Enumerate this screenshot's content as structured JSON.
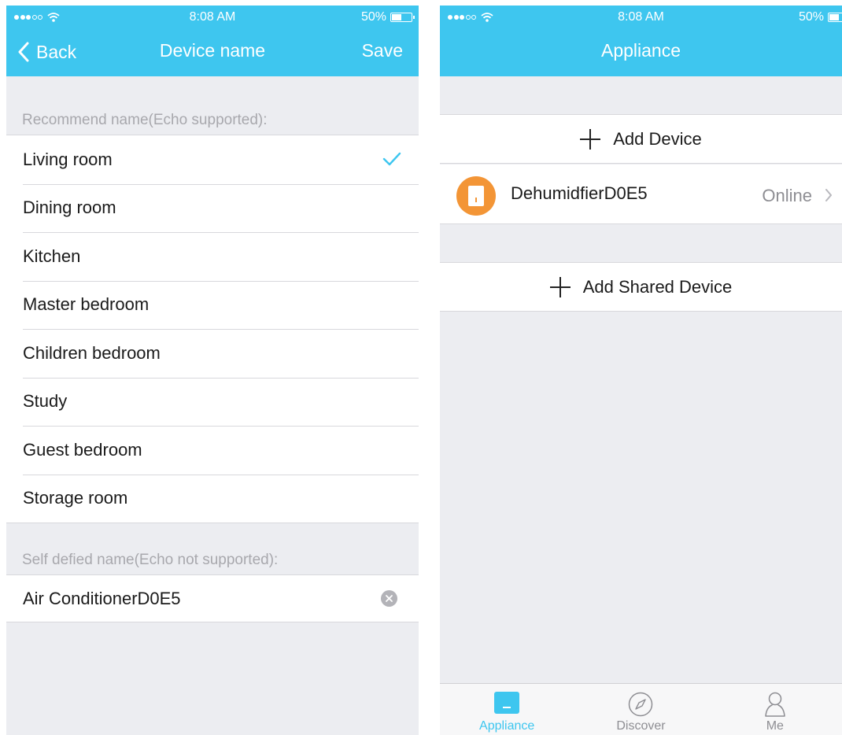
{
  "left_screen": {
    "status": {
      "time": "8:08 AM",
      "battery": "50%"
    },
    "nav": {
      "back_label": "Back",
      "title": "Device name",
      "save_label": "Save"
    },
    "recommend_label": "Recommend name(Echo supported):",
    "rooms": [
      {
        "label": "Living room",
        "selected": true
      },
      {
        "label": "Dining room"
      },
      {
        "label": "Kitchen"
      },
      {
        "label": "Master bedroom"
      },
      {
        "label": "Children bedroom"
      },
      {
        "label": "Study"
      },
      {
        "label": "Guest bedroom"
      },
      {
        "label": "Storage room"
      }
    ],
    "self_label": "Self defied name(Echo not supported):",
    "self_name_value": "Air ConditionerD0E5"
  },
  "right_screen": {
    "status": {
      "time": "8:08 AM",
      "battery": "50%"
    },
    "nav": {
      "title": "Appliance"
    },
    "add_device_label": "Add Device",
    "device": {
      "name": "DehumidfierD0E5",
      "status": "Online",
      "icon": "dehumidifier-icon"
    },
    "add_shared_label": "Add Shared Device",
    "tabs": [
      {
        "label": "Appliance",
        "icon": "appliance-icon",
        "active": true
      },
      {
        "label": "Discover",
        "icon": "compass-icon"
      },
      {
        "label": "Me",
        "icon": "person-icon"
      }
    ]
  },
  "colors": {
    "accent": "#3ec6ef",
    "device_icon": "#f39536",
    "background": "#ecedf1"
  }
}
